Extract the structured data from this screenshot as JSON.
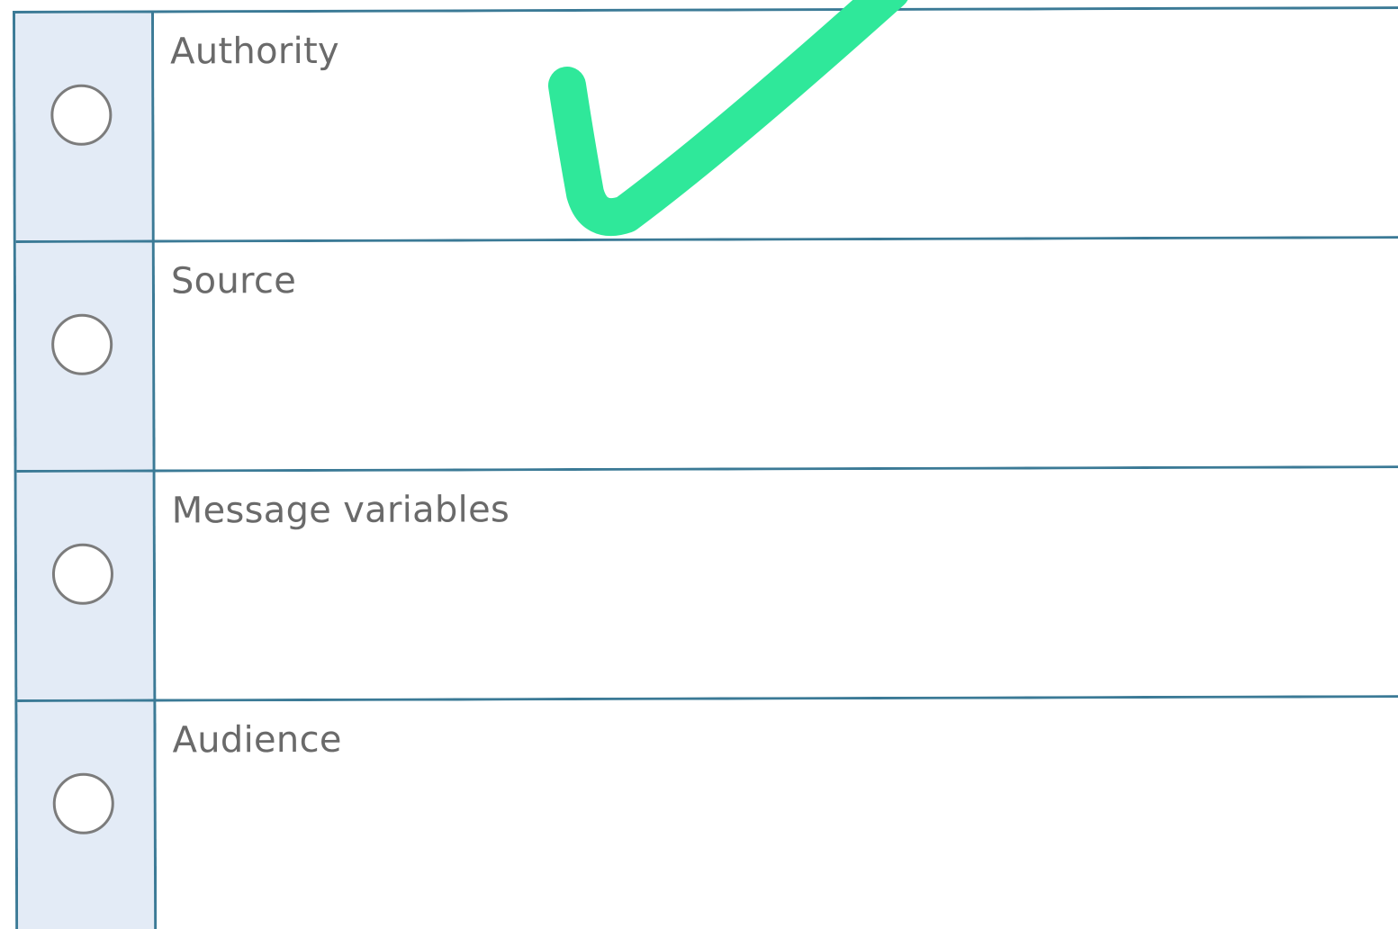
{
  "question": {
    "options": [
      {
        "label": "Authority",
        "selected": false
      },
      {
        "label": "Source",
        "selected": false
      },
      {
        "label": "Message variables",
        "selected": false
      },
      {
        "label": "Audience",
        "selected": false
      }
    ]
  },
  "annotation": {
    "icon": "checkmark-icon",
    "color": "#2fe89a",
    "marks_option": "Authority"
  },
  "colors": {
    "border": "#3b7a96",
    "radio_cell_bg": "#e3ebf6",
    "radio_border": "#7c7c7c",
    "label_text": "#6a6a6a"
  }
}
